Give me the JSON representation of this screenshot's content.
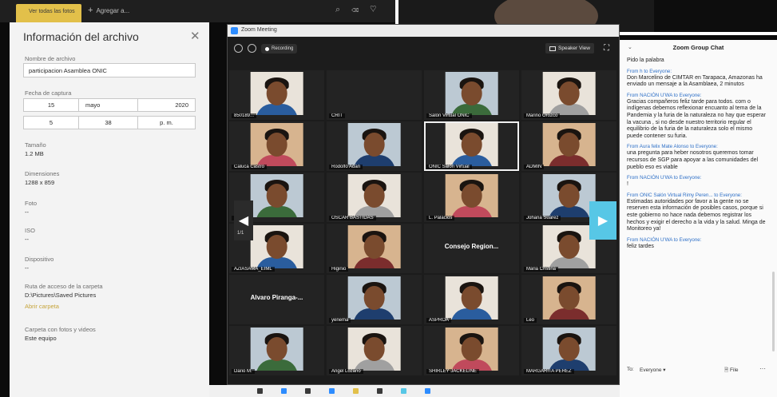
{
  "photos": {
    "tab_label": "Ver todas las fotos",
    "add_label": "Agregar a..."
  },
  "file_info": {
    "title": "Información del archivo",
    "filename_label": "Nombre de archivo",
    "filename": "participacion Asamblea ONIC",
    "date_label": "Fecha de captura",
    "day": "15",
    "month": "mayo",
    "year": "2020",
    "hour": "5",
    "minute": "38",
    "ampm": "p. m.",
    "size_label": "Tamaño",
    "size": "1.2 MB",
    "dimensions_label": "Dimensiones",
    "dimensions": "1288 x 859",
    "photo_label": "Foto",
    "photo_value": "--",
    "iso_label": "ISO",
    "iso_value": "--",
    "device_label": "Dispositivo",
    "device_value": "--",
    "path_label": "Ruta de acceso de la carpeta",
    "path": "D:\\Pictures\\Saved Pictures",
    "open_folder": "Abrir carpeta",
    "folder_label": "Carpeta con fotos y videos",
    "folder": "Este equipo"
  },
  "zoom": {
    "window_title": "Zoom Meeting",
    "recording_label": "Recording",
    "speaker_view_label": "Speaker View",
    "page_indicator": "1/1",
    "tiles": [
      {
        "name": "850189...",
        "kind": "cam"
      },
      {
        "name": "CRIT",
        "kind": "dark"
      },
      {
        "name": "Salón Virtual ONIC",
        "kind": "cam"
      },
      {
        "name": "Marino Orozco",
        "kind": "cam"
      },
      {
        "name": "Caluca Castro",
        "kind": "cam"
      },
      {
        "name": "Rodolfo Adán",
        "kind": "cam"
      },
      {
        "name": "ONIC Salón Virtual",
        "kind": "cam"
      },
      {
        "name": "ADMIN",
        "kind": "cam"
      },
      {
        "name": "L.Eltro",
        "kind": "cam"
      },
      {
        "name": "OSCAR BASTIDAS",
        "kind": "cam"
      },
      {
        "name": "L. Palacios",
        "kind": "cam"
      },
      {
        "name": "Johana Suárez",
        "kind": "cam"
      },
      {
        "name": "AZIASAMA_EIML",
        "kind": "cam"
      },
      {
        "name": "Higinio",
        "kind": "cam"
      },
      {
        "name": "Consejo Region...",
        "kind": "text"
      },
      {
        "name": "Maria Cristina",
        "kind": "cam"
      },
      {
        "name": "Alvaro Piranga-...",
        "kind": "text"
      },
      {
        "name": "yenema",
        "kind": "cam"
      },
      {
        "name": "ASPROA",
        "kind": "cam"
      },
      {
        "name": "Leo",
        "kind": "cam"
      },
      {
        "name": "Dario M.",
        "kind": "cam"
      },
      {
        "name": "Ángel Lozano",
        "kind": "cam"
      },
      {
        "name": "SHIRLEY JACKELINE",
        "kind": "cam"
      },
      {
        "name": "MARGARITA PÉREZ",
        "kind": "cam"
      }
    ]
  },
  "chat": {
    "title": "Zoom Group Chat",
    "messages": [
      {
        "from": "",
        "text": "Pido la palabra"
      },
      {
        "from": "From h to Everyone:",
        "text": "Don Marcelino de CIMTAR en Tarapaca, Amazonas ha enviado un mensaje a la Asamblaea, 2 minutos"
      },
      {
        "from": "From NACIÓN U'WA to Everyone:",
        "text": "Gracias compañeros feliz tarde para todos. com o indígenas debemos reflexionar encuanto al tema de la Pandemia y la furia de la naturaleza no hay que esperar la vacuna , si no desde nuestro territorio regular el equilibrio de la furia de la naturaleza solo el mismo puede contener su furia."
      },
      {
        "from": "From Aura felix Mate Alonso to Everyone:",
        "text": "una pregunta para heber nosotros queremos tomar recursos de SGP para apoyar a las comunidades del pueblo eso es viable"
      },
      {
        "from": "From NACIÓN U'WA to Everyone:",
        "text": "!"
      },
      {
        "from": "From ONIC Salón Virtual Rimy Peren... to Everyone:",
        "text": "Estimadas autoridades por favor a la gente no se reserven esta información de posibles casos, porque si este gobierno no hace nada debemos registrar los hechos y exigir el derecho a la vida y la salud. Minga de Monitoreo ya!"
      },
      {
        "from": "From NACIÓN U'WA to Everyone:",
        "text": "feliz tardes"
      }
    ],
    "to_label": "To:",
    "to_value": "Everyone ▾",
    "file_label": "File",
    "more_label": "···"
  },
  "colors": {
    "accent_yellow": "#e2c04a",
    "zoom_blue": "#2d8cff",
    "nav_cyan": "#57c7e6",
    "chat_link": "#2d6fc7"
  }
}
